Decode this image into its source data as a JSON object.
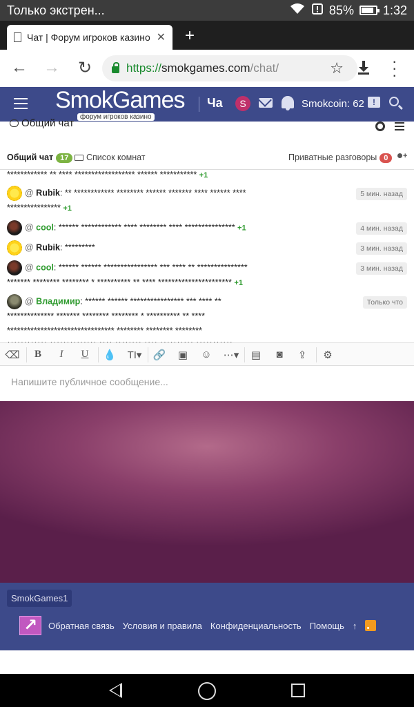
{
  "status_bar": {
    "notification": "Только экстрен...",
    "battery": "85%",
    "battery_level": 0.85,
    "time": "1:32"
  },
  "browser": {
    "tab_title": "Чат | Форум игроков казино",
    "url_scheme": "https://",
    "url_host": "smokgames.com",
    "url_path": "/chat/"
  },
  "site": {
    "logo_text": "SmokGames",
    "logo_subtitle": "форум игроков казино",
    "nav_current": "Ча",
    "avatar_letter": "S",
    "smokcoin": "Smokcoin: 62",
    "chat_badge": "!"
  },
  "chat": {
    "panel_title": "Общий чат",
    "tab_general": "Общий чат",
    "general_count": "17",
    "tab_rooms": "Список комнат",
    "tab_private": "Приватные разговоры",
    "private_count": "0",
    "messages": [
      {
        "line1": "************ ** **** ****************** ****** ***********",
        "plus": "+1"
      },
      {
        "author": "Rubik",
        "text": "** ************ ******** ****** ******* **** ****** ****",
        "cont": "****************",
        "plus": "+1",
        "time": "5 мин. назад"
      },
      {
        "author": "cool",
        "text": "****** ************ **** ******** **** ***************",
        "plus": "+1",
        "time": "4 мин. назад"
      },
      {
        "author": "Rubik",
        "text": "*********",
        "time": "3 мин. назад"
      },
      {
        "author": "cool",
        "text": "****** ****** **************** *** **** ** ***************",
        "cont": "******* ******** ******** * ********** ** **** **********************",
        "plus": "+1",
        "time": "3 мин. назад"
      },
      {
        "author": "Владимир",
        "text": "****** ****** **************** *** **** **",
        "cont": "************** ******* ******** ******** * ********** ** ****",
        "cont2": "******************************** ******** ******** ********",
        "cont3": "************ ************** **** ******** **** ********** ***********",
        "time": "Только что"
      }
    ],
    "composer_placeholder": "Напишите публичное сообщение..."
  },
  "footer": {
    "style_chip": "SmokGames1",
    "links": [
      "Обратная связь",
      "Условия и правила",
      "Конфиденциальность",
      "Помощь"
    ],
    "up_arrow": "↑"
  },
  "colors": {
    "header_bg": "#3d4a8a",
    "green_nick": "#2e9a2e",
    "badge_green": "#7cb342",
    "badge_red": "#d9534f"
  }
}
